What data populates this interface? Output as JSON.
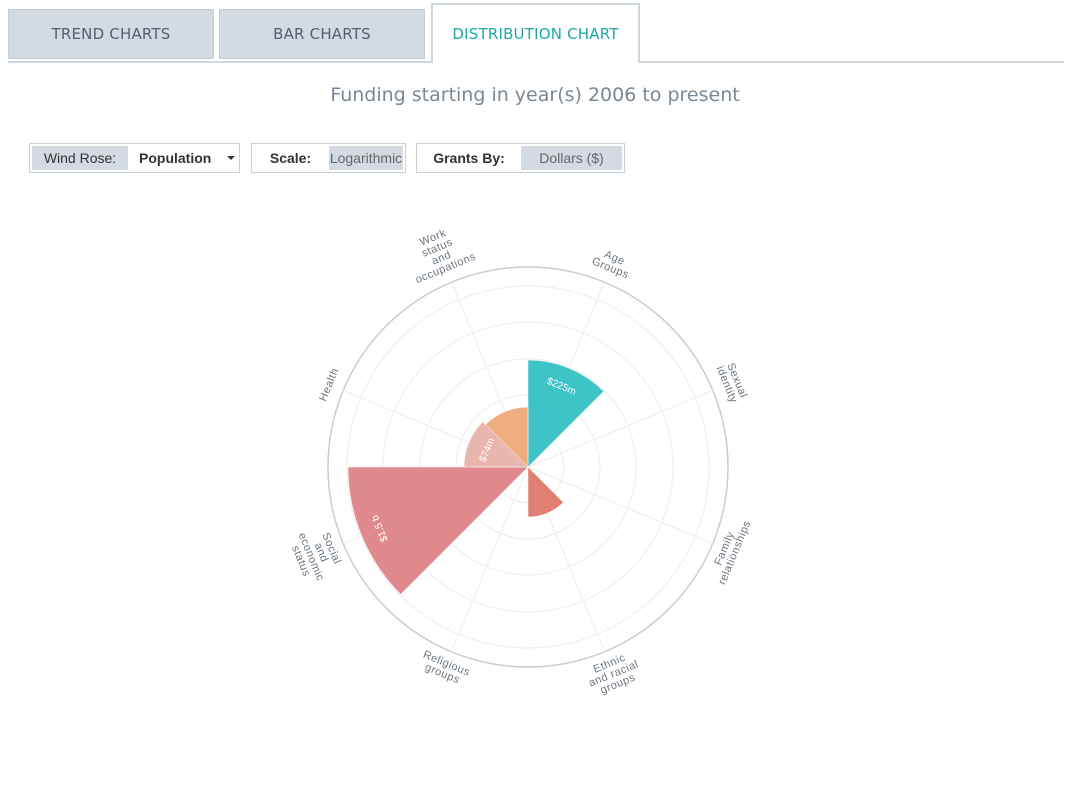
{
  "tabs": [
    {
      "label": "TREND CHARTS",
      "active": false
    },
    {
      "label": "BAR CHARTS",
      "active": false
    },
    {
      "label": "DISTRIBUTION CHART",
      "active": true
    }
  ],
  "subtitle": "Funding starting in year(s) 2006 to present",
  "controls": {
    "wind_rose": {
      "label": "Wind Rose:",
      "value": "Population"
    },
    "scale": {
      "label": "Scale:",
      "value": "Logarithmic"
    },
    "grants_by": {
      "label": "Grants By:",
      "value": "Dollars ($)"
    }
  },
  "colors": {
    "accent": "#1fa7a7",
    "tab_bg": "#d3dae2"
  },
  "chart_data": {
    "type": "polar-area",
    "scale": "logarithmic",
    "categories": [
      {
        "name": "Age Groups",
        "lines": [
          "Age",
          "Groups"
        ],
        "value_frac": 0.535,
        "color": "#3ec3c6",
        "label": "$225m"
      },
      {
        "name": "Sexual identity",
        "lines": [
          "Sexual",
          "identity"
        ],
        "value_frac": 0,
        "color": "#cccccc",
        "label": ""
      },
      {
        "name": "Family relationships",
        "lines": [
          "Family",
          "relationships"
        ],
        "value_frac": 0,
        "color": "#cccccc",
        "label": ""
      },
      {
        "name": "Ethnic and racial groups",
        "lines": [
          "Ethnic",
          "and racial",
          "groups"
        ],
        "value_frac": 0.25,
        "color": "#e07f72",
        "label": ""
      },
      {
        "name": "Religious groups",
        "lines": [
          "Religious",
          "groups"
        ],
        "value_frac": 0,
        "color": "#cccccc",
        "label": ""
      },
      {
        "name": "Social and economic status",
        "lines": [
          "Social",
          "and",
          "economic",
          "status"
        ],
        "value_frac": 0.9,
        "color": "#e08a8e",
        "label": "$1.5 b"
      },
      {
        "name": "Health",
        "lines": [
          "Health"
        ],
        "value_frac": 0.32,
        "color": "#e9b6ae",
        "label": "$74m"
      },
      {
        "name": "Work status and occupations",
        "lines": [
          "Work",
          "status",
          "and",
          "occupations"
        ],
        "value_frac": 0.3,
        "color": "#efae80",
        "label": ""
      }
    ]
  }
}
